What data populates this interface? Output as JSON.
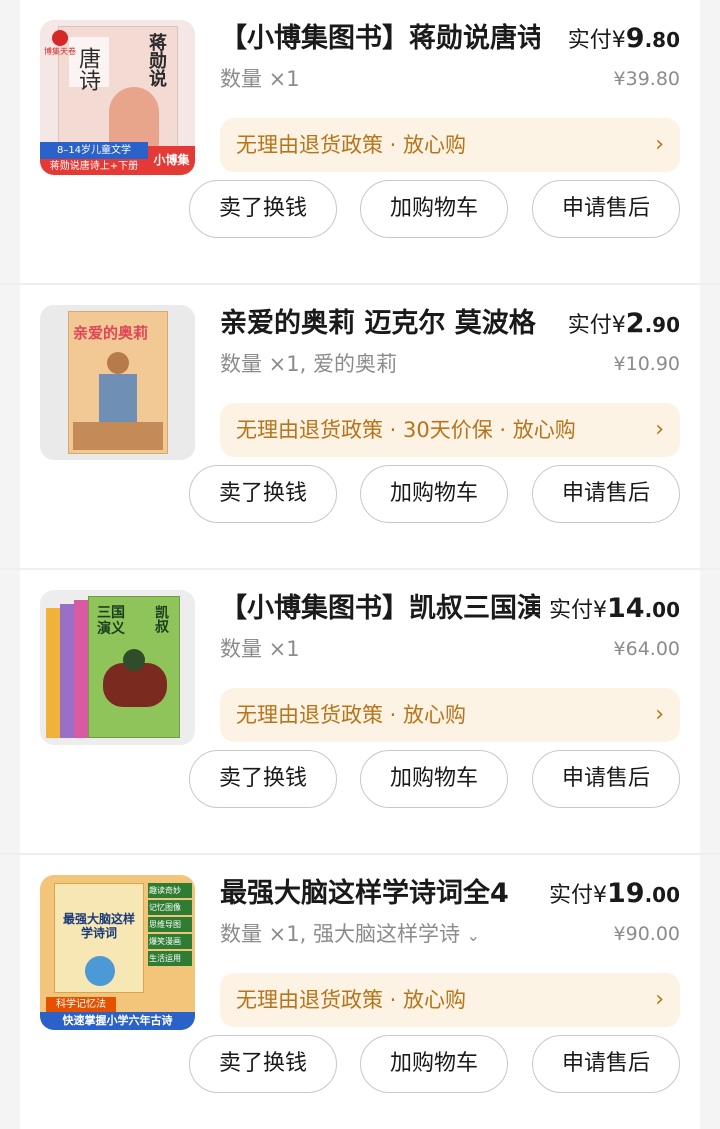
{
  "orders": [
    {
      "title": "【小博集图书】蒋勋说唐诗",
      "price_label": "实付",
      "currency": "¥",
      "price_int": "9",
      "price_dec": ".80",
      "quantity": "数量 ×1",
      "original_price": "¥39.80",
      "policy": "无理由退货政策 · 放心购",
      "cover": {
        "banner": "8–14岁儿童文学",
        "subbanner": "蒋勋说唐诗上+下册",
        "brand": "小博集",
        "publisher": "博集天卷",
        "cover_title": "唐诗",
        "cover_title_right": "蒋勋说"
      }
    },
    {
      "title": "亲爱的奥莉 迈克尔 莫波格",
      "price_label": "实付",
      "currency": "¥",
      "price_int": "2",
      "price_dec": ".90",
      "quantity": "数量 ×1, 爱的奥莉",
      "original_price": "¥10.90",
      "policy": "无理由退货政策 · 30天价保 · 放心购",
      "cover": {
        "cover_title": "亲爱的奥莉"
      }
    },
    {
      "title": "【小博集图书】凯叔三国演",
      "price_label": "实付",
      "currency": "¥",
      "price_int": "14",
      "price_dec": ".00",
      "quantity": "数量 ×1",
      "original_price": "¥64.00",
      "policy": "无理由退货政策 · 放心购",
      "cover": {
        "cover_title": "三国演义",
        "cover_title_right": "凯叔"
      }
    },
    {
      "title": "最强大脑这样学诗词全4",
      "price_label": "实付",
      "currency": "¥",
      "price_int": "19",
      "price_dec": ".00",
      "quantity": "数量 ×1, 强大脑这样学诗",
      "original_price": "¥90.00",
      "policy": "无理由退货政策 · 放心购",
      "cover": {
        "banner": "科学记忆法",
        "subbanner": "快速掌握小学六年古诗",
        "cover_title": "最强大脑这样学诗词",
        "tags": [
          "趣读奇妙",
          "记忆图像",
          "思维导图",
          "爆笑漫画",
          "生活运用"
        ]
      }
    }
  ],
  "buttons": {
    "sell": "卖了换钱",
    "add_cart": "加购物车",
    "after_sale": "申请售后"
  },
  "colors": {
    "accent": "#b8741a",
    "policy_bg": "#fdf3e4"
  }
}
